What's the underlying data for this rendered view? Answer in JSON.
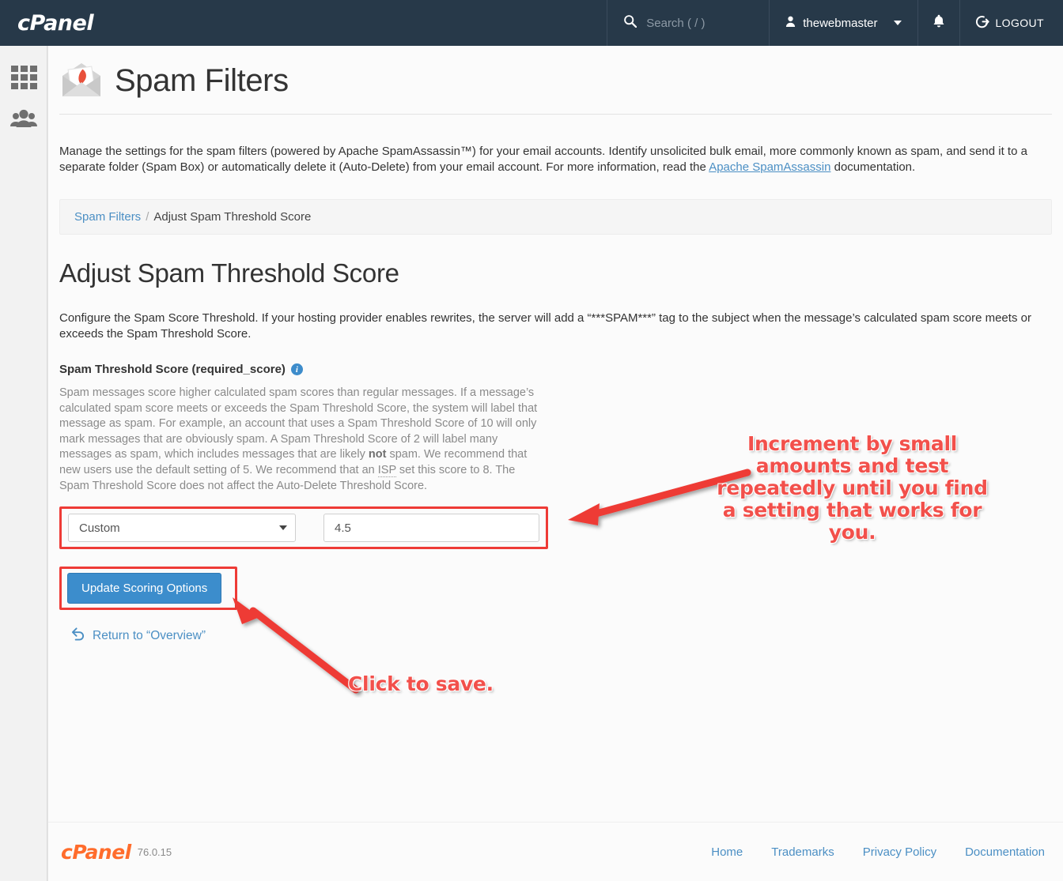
{
  "topbar": {
    "brand": "cPanel",
    "search_placeholder": "Search ( / )",
    "search_value": "",
    "search_icon": "search-icon",
    "user": "thewebmaster",
    "user_icon": "user-icon",
    "bell_icon": "bell-icon",
    "logout_label": "LOGOUT",
    "logout_icon": "logout-icon",
    "bg_color": "#273949"
  },
  "sidebar": {
    "items": [
      {
        "icon": "grid-apps-icon",
        "name": "apps"
      },
      {
        "icon": "users-group-icon",
        "name": "user-manager"
      }
    ]
  },
  "page": {
    "title": "Spam Filters",
    "icon": "spam-filters-envelope-feather-icon",
    "intro_part1": "Manage the settings for the spam filters (powered by Apache SpamAssassin™) for your email accounts. Identify unsolicited bulk email, more commonly known as spam, and send it to a separate folder (Spam Box) or automatically delete it (Auto-Delete) from your email account. For more information, read the ",
    "intro_link": "Apache SpamAssassin",
    "intro_part2": " documentation."
  },
  "breadcrumb": {
    "root": "Spam Filters",
    "separator": "/",
    "current": "Adjust Spam Threshold Score"
  },
  "section": {
    "heading": "Adjust Spam Threshold Score",
    "description": "Configure the Spam Score Threshold. If your hosting provider enables rewrites, the server will add a “***SPAM***” tag to the subject when the message’s calculated spam score meets or exceeds the Spam Threshold Score."
  },
  "field": {
    "label": "Spam Threshold Score (required_score)",
    "info_icon": "info-icon",
    "help_part1": "Spam messages score higher calculated spam scores than regular messages. If a message’s calculated spam score meets or exceeds the Spam Threshold Score, the system will label that message as spam. For example, an account that uses a Spam Threshold Score of 10 will only mark messages that are obviously spam. A Spam Threshold Score of 2 will label many messages as spam, which includes messages that are likely ",
    "help_bold": "not",
    "help_part2": " spam. We recommend that new users use the default setting of 5. We recommend that an ",
    "help_abbr": "ISP",
    "help_part3": " set this score to 8. The Spam Threshold Score does not affect the Auto-Delete Threshold Score.",
    "select_value": "Custom",
    "select_options": [
      "Custom"
    ],
    "score_value": "4.5"
  },
  "actions": {
    "submit_label": "Update Scoring Options",
    "return_label": "Return to “Overview”",
    "return_icon": "undo-arrow-icon"
  },
  "annotations": {
    "threshold_note": "Increment by small amounts and test repeatedly until you find a setting that works for you.",
    "save_note": "Click to save.",
    "color": "#f2504b",
    "arrow_to_input": "arrow-left-icon",
    "arrow_to_button": "arrow-up-left-icon"
  },
  "footer": {
    "logo": "cPanel",
    "version": "76.0.15",
    "links": [
      {
        "label": "Home"
      },
      {
        "label": "Trademarks"
      },
      {
        "label": "Privacy Policy"
      },
      {
        "label": "Documentation"
      }
    ]
  }
}
